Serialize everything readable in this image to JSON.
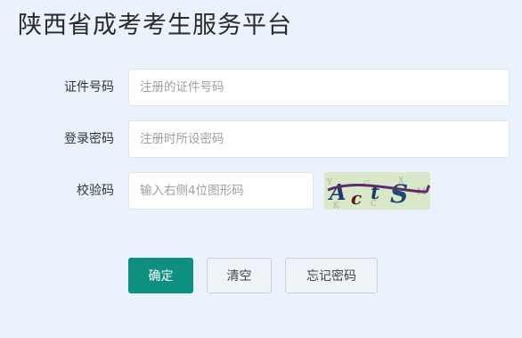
{
  "page": {
    "title": "陕西省成考考生服务平台"
  },
  "form": {
    "id_number": {
      "label": "证件号码",
      "placeholder": "注册的证件号码",
      "value": ""
    },
    "password": {
      "label": "登录密码",
      "placeholder": "注册时所设密码",
      "value": ""
    },
    "captcha": {
      "label": "校验码",
      "placeholder": "输入右侧4位图形码",
      "value": "",
      "image_text": "Acts"
    }
  },
  "buttons": {
    "confirm": "确定",
    "clear": "清空",
    "forgot_password": "忘记密码"
  },
  "colors": {
    "background": "#eaf3fb",
    "primary": "#0f8f7f",
    "input_border": "#dfe4ea"
  }
}
